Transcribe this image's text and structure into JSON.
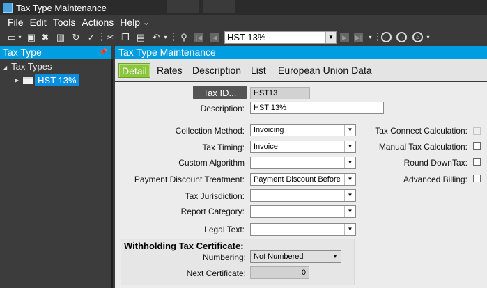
{
  "window": {
    "title": "Tax Type Maintenance"
  },
  "menu": {
    "items": [
      "File",
      "Edit",
      "Tools",
      "Actions",
      "Help"
    ],
    "more": "⌄"
  },
  "toolbar": {
    "record_value": "HST 13%",
    "icons": [
      "new-icon",
      "save-icon",
      "delete-icon",
      "book-icon",
      "refresh-icon",
      "clear-icon",
      "cut-icon",
      "copy-icon",
      "paste-icon",
      "undo-icon",
      "search-icon",
      "first-icon",
      "previous-icon",
      "next-icon",
      "last-icon",
      "back-icon",
      "forward-icon",
      "home-icon"
    ]
  },
  "side_panel": {
    "title": "Tax Type",
    "tree_root": "Tax Types",
    "tree_node": "HST 13%"
  },
  "main": {
    "title": "Tax Type Maintenance",
    "tabs": [
      "Detail",
      "Rates",
      "Description",
      "List",
      "European Union Data"
    ],
    "active_tab": "Detail"
  },
  "form": {
    "tax_id": {
      "label": "Tax ID...",
      "value": "HST13"
    },
    "description": {
      "label": "Description:",
      "value": "HST 13%"
    },
    "collection_method": {
      "label": "Collection Method:",
      "value": "Invoicing"
    },
    "tax_timing": {
      "label": "Tax Timing:",
      "value": "Invoice"
    },
    "custom_algorithm": {
      "label": "Custom Algorithm",
      "value": ""
    },
    "payment_discount_treatment": {
      "label": "Payment Discount Treatment:",
      "value": "Payment Discount Before"
    },
    "tax_jurisdiction": {
      "label": "Tax Jurisdiction:",
      "value": ""
    },
    "report_category": {
      "label": "Report Category:",
      "value": ""
    },
    "legal_text": {
      "label": "Legal Text:",
      "value": ""
    },
    "tax_connect_calculation": {
      "label": "Tax Connect Calculation:",
      "checked": false,
      "enabled": false
    },
    "manual_tax_calculation": {
      "label": "Manual Tax Calculation:",
      "checked": false
    },
    "round_down_tax": {
      "label": "Round DownTax:",
      "checked": false
    },
    "advanced_billing": {
      "label": "Advanced Billing:",
      "checked": false
    },
    "withholding": {
      "title": "Withholding Tax Certificate:",
      "numbering": {
        "label": "Numbering:",
        "value": "Not Numbered"
      },
      "next_certificate": {
        "label": "Next Certificate:",
        "value": "0"
      }
    }
  }
}
